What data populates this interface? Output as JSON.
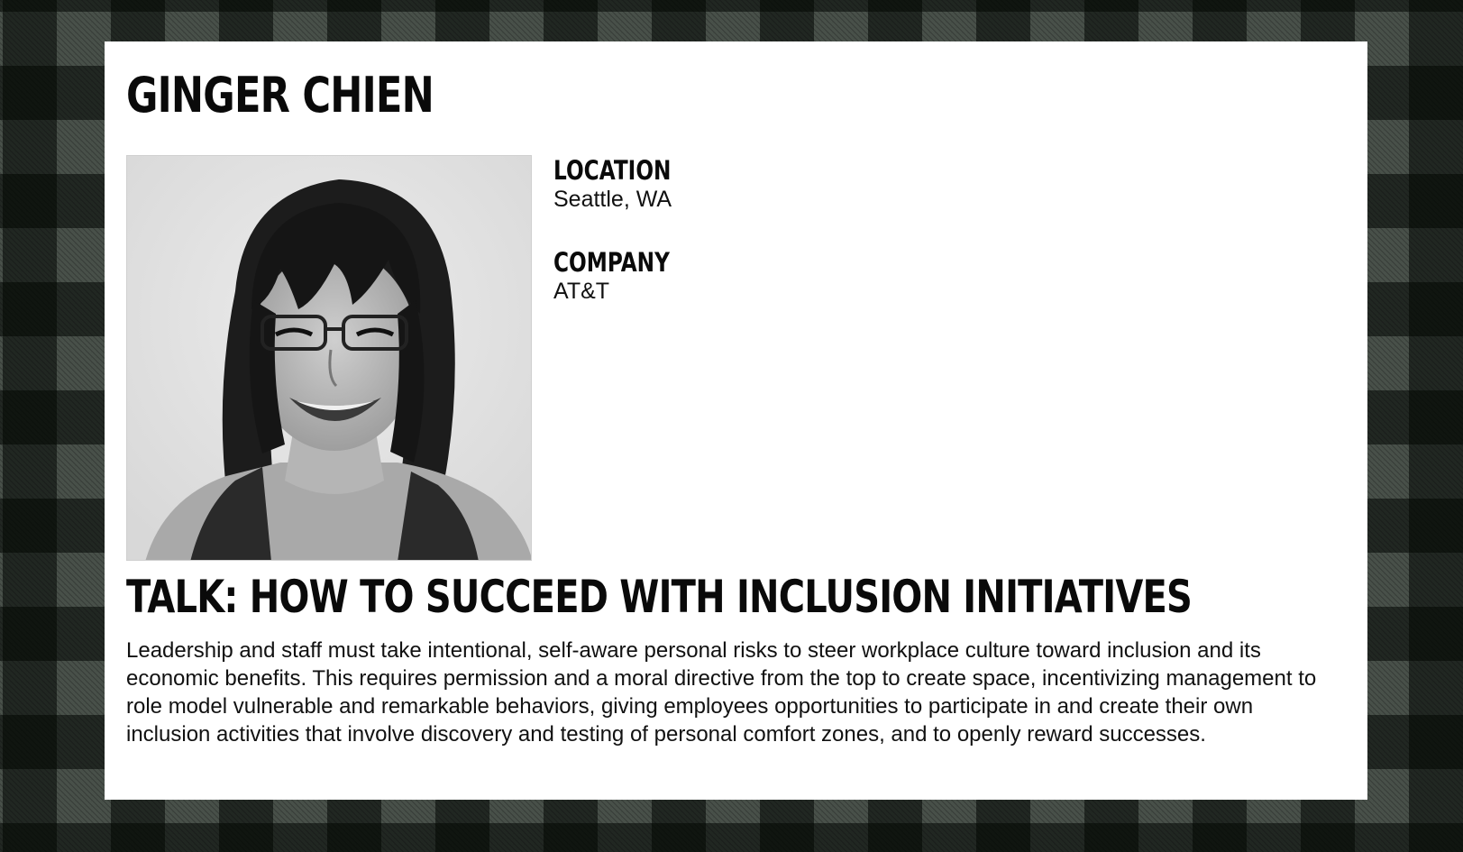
{
  "speaker": {
    "name": "GINGER CHIEN",
    "photo_alt": "speaker-photo"
  },
  "details": {
    "location_label": "LOCATION",
    "location_value": "Seattle, WA",
    "company_label": "COMPANY",
    "company_value": "AT&T"
  },
  "talk": {
    "title": "TALK: HOW TO SUCCEED WITH INCLUSION INITIATIVES",
    "description": "Leadership and staff must take intentional, self-aware personal risks to steer workplace culture toward inclusion and its economic benefits. This requires permission and a moral directive from the top to create space, incentivizing management to role model vulnerable and remarkable behaviors, giving employees opportunities to participate in and create their own inclusion activities that involve discovery and testing of personal comfort zones, and to openly reward successes."
  },
  "colors": {
    "card_background": "#ffffff",
    "text": "#0a0a0a",
    "plaid_light": "#485049",
    "plaid_dark": "#050905"
  }
}
